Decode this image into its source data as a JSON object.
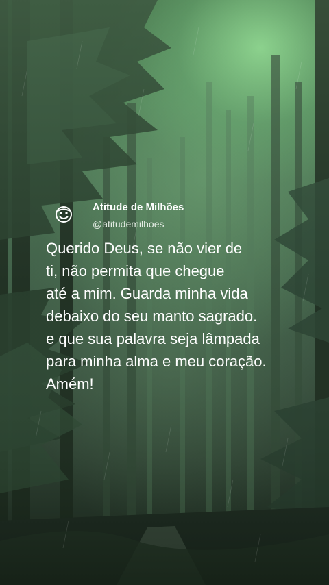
{
  "post": {
    "author_name": "Atitude de Milhões",
    "author_handle": "@atitudemilhoes",
    "avatar_icon": "smiley-face-icon",
    "message_lines": [
      "Querido Deus, se não vier de",
      "ti, não permita que chegue",
      "até a mim. Guarda minha vida",
      "debaixo do seu manto sagrado.",
      "e que sua palavra seja lâmpada",
      "para minha alma e meu coração.",
      "Amém!"
    ]
  },
  "colors": {
    "text": "#ffffff",
    "handle": "#e4ece4",
    "sky_glow": "#96e696",
    "forest_dark": "#151f18"
  }
}
